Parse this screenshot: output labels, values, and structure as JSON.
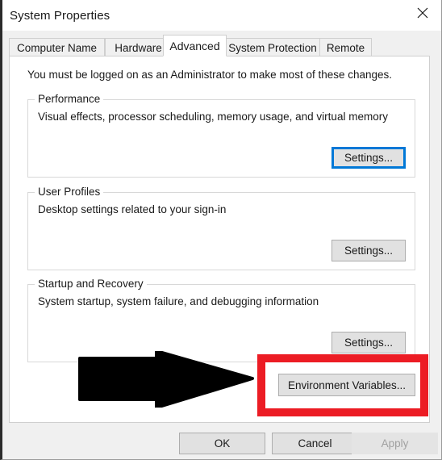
{
  "window": {
    "title": "System Properties",
    "close_icon": "close-icon"
  },
  "tabs": [
    {
      "label": "Computer Name",
      "selected": false
    },
    {
      "label": "Hardware",
      "selected": false
    },
    {
      "label": "Advanced",
      "selected": true
    },
    {
      "label": "System Protection",
      "selected": false
    },
    {
      "label": "Remote",
      "selected": false
    }
  ],
  "content": {
    "admin_notice": "You must be logged on as an Administrator to make most of these changes.",
    "groups": [
      {
        "legend": "Performance",
        "description": "Visual effects, processor scheduling, memory usage, and virtual memory",
        "button_label": "Settings...",
        "button_focused": true
      },
      {
        "legend": "User Profiles",
        "description": "Desktop settings related to your sign-in",
        "button_label": "Settings...",
        "button_focused": false
      },
      {
        "legend": "Startup and Recovery",
        "description": "System startup, system failure, and debugging information",
        "button_label": "Settings...",
        "button_focused": false
      }
    ],
    "environment_variables_label": "Environment Variables..."
  },
  "annotations": {
    "arrow": {
      "name": "black-arrow-annotation",
      "color": "#000000",
      "direction": "right"
    },
    "highlight": {
      "name": "red-rectangle-annotation",
      "color": "#ec1c24",
      "target": "environment-variables-button"
    }
  },
  "footer": {
    "ok_label": "OK",
    "cancel_label": "Cancel",
    "apply_label": "Apply",
    "apply_disabled": true
  },
  "colors": {
    "accent_focus": "#0078d7",
    "annotation_red": "#ec1c24",
    "dialog_background": "#f0f0f0",
    "panel_background": "#ffffff",
    "button_face": "#e1e1e1"
  }
}
